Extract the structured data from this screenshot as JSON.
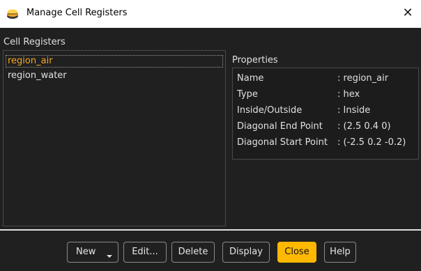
{
  "window": {
    "title": "Manage Cell Registers",
    "close_glyph": "✕",
    "app_icon": "fluent-layers-icon"
  },
  "cell_registers": {
    "label": "Cell Registers",
    "items": [
      {
        "label": "region_air",
        "selected": true
      },
      {
        "label": "region_water",
        "selected": false
      }
    ]
  },
  "properties": {
    "label": "Properties",
    "rows": [
      {
        "key": "Name",
        "value": ": region_air"
      },
      {
        "key": "Type",
        "value": ": hex"
      },
      {
        "key": "Inside/Outside",
        "value": ": Inside"
      },
      {
        "key": "Diagonal End Point",
        "value": ": (2.5 0.4 0)"
      },
      {
        "key": "Diagonal Start Point",
        "value": ": (-2.5 0.2 -0.2)"
      }
    ]
  },
  "buttons": {
    "new": "New",
    "edit": "Edit...",
    "delete": "Delete",
    "display": "Display",
    "close": "Close",
    "help": "Help"
  },
  "colors": {
    "selected_text": "#f5a623",
    "primary_button": "#ffb800",
    "background": "#202020"
  }
}
